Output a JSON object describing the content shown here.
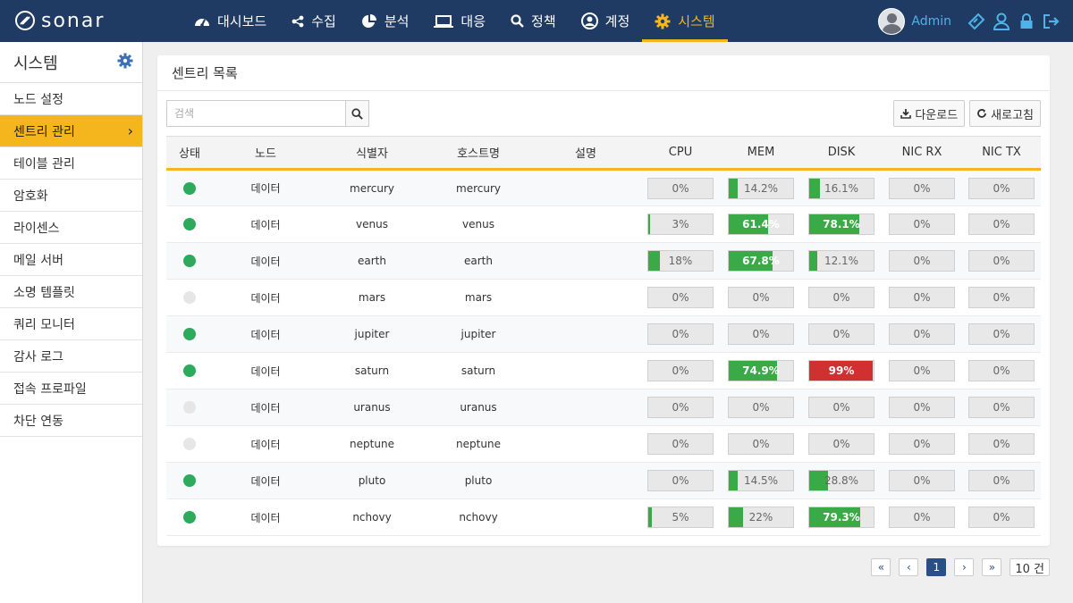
{
  "brand": {
    "name": "sonar"
  },
  "nav": [
    {
      "label": "대시보드",
      "icon": "dashboard-icon"
    },
    {
      "label": "수집",
      "icon": "share-icon"
    },
    {
      "label": "분석",
      "icon": "pie-chart-icon"
    },
    {
      "label": "대응",
      "icon": "laptop-icon"
    },
    {
      "label": "정책",
      "icon": "search-icon"
    },
    {
      "label": "계정",
      "icon": "user-circle-icon"
    },
    {
      "label": "시스템",
      "icon": "gear-icon",
      "active": true
    }
  ],
  "user": {
    "name": "Admin"
  },
  "sidebar": {
    "title": "시스템",
    "items": [
      {
        "label": "노드 설정"
      },
      {
        "label": "센트리 관리",
        "active": true
      },
      {
        "label": "테이블 관리"
      },
      {
        "label": "암호화"
      },
      {
        "label": "라이센스"
      },
      {
        "label": "메일 서버"
      },
      {
        "label": "소명 템플릿"
      },
      {
        "label": "쿼리 모니터"
      },
      {
        "label": "감사 로그"
      },
      {
        "label": "접속 프로파일"
      },
      {
        "label": "차단 연동"
      }
    ]
  },
  "panel": {
    "title": "센트리 목록",
    "search_placeholder": "검색",
    "download_label": "다운로드",
    "refresh_label": "새로고침"
  },
  "table": {
    "headers": [
      "상태",
      "노드",
      "식별자",
      "호스트명",
      "설명",
      "CPU",
      "MEM",
      "DISK",
      "NIC RX",
      "NIC TX"
    ],
    "rows": [
      {
        "online": true,
        "node": "데이터",
        "id": "mercury",
        "host": "mercury",
        "desc": "",
        "cpu": "0%",
        "mem": "14.2%",
        "disk": "16.1%",
        "rx": "0%",
        "tx": "0%"
      },
      {
        "online": true,
        "node": "데이터",
        "id": "venus",
        "host": "venus",
        "desc": "",
        "cpu": "3%",
        "mem": "61.4%",
        "disk": "78.1%",
        "rx": "0%",
        "tx": "0%"
      },
      {
        "online": true,
        "node": "데이터",
        "id": "earth",
        "host": "earth",
        "desc": "",
        "cpu": "18%",
        "mem": "67.8%",
        "disk": "12.1%",
        "rx": "0%",
        "tx": "0%"
      },
      {
        "online": false,
        "node": "데이터",
        "id": "mars",
        "host": "mars",
        "desc": "",
        "cpu": "0%",
        "mem": "0%",
        "disk": "0%",
        "rx": "0%",
        "tx": "0%"
      },
      {
        "online": true,
        "node": "데이터",
        "id": "jupiter",
        "host": "jupiter",
        "desc": "",
        "cpu": "0%",
        "mem": "0%",
        "disk": "0%",
        "rx": "0%",
        "tx": "0%"
      },
      {
        "online": true,
        "node": "데이터",
        "id": "saturn",
        "host": "saturn",
        "desc": "",
        "cpu": "0%",
        "mem": "74.9%",
        "disk": "99%",
        "rx": "0%",
        "tx": "0%"
      },
      {
        "online": false,
        "node": "데이터",
        "id": "uranus",
        "host": "uranus",
        "desc": "",
        "cpu": "0%",
        "mem": "0%",
        "disk": "0%",
        "rx": "0%",
        "tx": "0%"
      },
      {
        "online": false,
        "node": "데이터",
        "id": "neptune",
        "host": "neptune",
        "desc": "",
        "cpu": "0%",
        "mem": "0%",
        "disk": "0%",
        "rx": "0%",
        "tx": "0%"
      },
      {
        "online": true,
        "node": "데이터",
        "id": "pluto",
        "host": "pluto",
        "desc": "",
        "cpu": "0%",
        "mem": "14.5%",
        "disk": "28.8%",
        "rx": "0%",
        "tx": "0%"
      },
      {
        "online": true,
        "node": "데이터",
        "id": "nchovy",
        "host": "nchovy",
        "desc": "",
        "cpu": "5%",
        "mem": "22%",
        "disk": "79.3%",
        "rx": "0%",
        "tx": "0%"
      }
    ]
  },
  "pagination": {
    "first": "«",
    "prev": "‹",
    "current": "1",
    "next": "›",
    "last": "»",
    "count": "10 건"
  },
  "colors": {
    "topbar": "#1f3a63",
    "accent": "#f5b51d",
    "bar_ok": "#3aaa48",
    "bar_danger": "#d0302f",
    "online": "#2eaa5c"
  }
}
